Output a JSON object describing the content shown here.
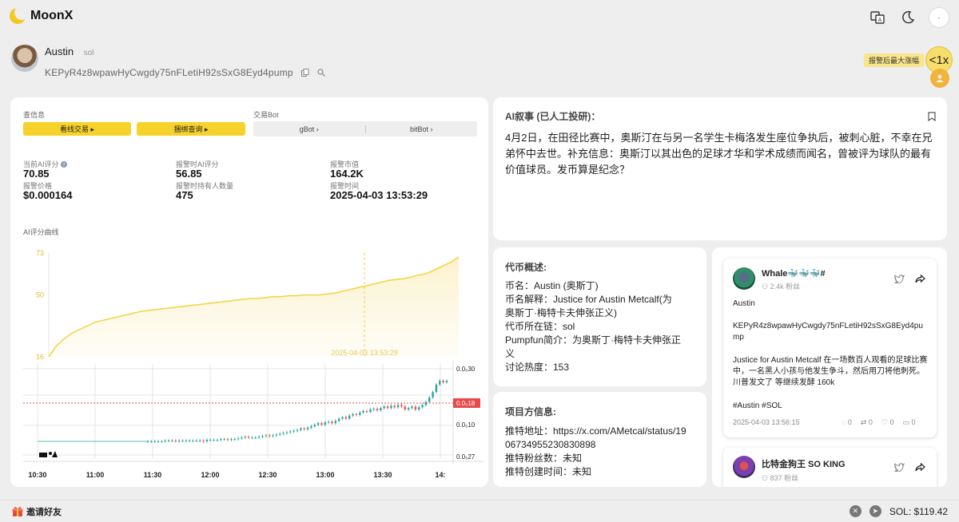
{
  "app": {
    "name": "MoonX"
  },
  "token": {
    "name": "Austin",
    "chain": "sol",
    "address": "KEPyR4z8wpawHyCwgdy75nFLetiH92sSxG8Eyd4pump"
  },
  "header_badges": {
    "max_rise_label": "报警后最大涨幅",
    "multiplier": "<1x"
  },
  "left": {
    "info_label": "查信息",
    "btn_trade": "看线交易 ▸",
    "btn_bundle": "捆绑查询 ▸",
    "bot_label": "交易Bot",
    "gbot": "gBot ›",
    "bitbot": "bitBot ›",
    "stats": {
      "cur_ai_label": "当前AI评分",
      "cur_ai_value": "70.85",
      "alert_ai_label": "报警时AI评分",
      "alert_ai_value": "56.85",
      "alert_mcap_label": "报警市值",
      "alert_mcap_value": "164.2K",
      "alert_price_label": "报警价格",
      "alert_price_value": "$0.000164",
      "holders_label": "报警时持有人数量",
      "holders_value": "475",
      "alert_time_label": "报警时间",
      "alert_time_value": "2025-04-03 13:53:29"
    },
    "curve_label": "AI评分曲线"
  },
  "chart_data": [
    {
      "type": "area",
      "title": "AI评分曲线",
      "y_ticks": [
        "73",
        "50",
        "16"
      ],
      "ylim": [
        16,
        73
      ],
      "marker_label": "2025-04-03 13:53:29",
      "marker_fraction": 0.77,
      "series": [
        {
          "values": [
            16,
            22,
            26,
            29,
            31,
            33,
            35,
            36,
            37,
            38,
            39,
            40,
            41,
            41.5,
            42,
            42.5,
            43,
            43.5,
            44,
            44.5,
            45,
            45.5,
            46,
            46.5,
            47,
            47.5,
            48,
            48,
            48.5,
            49,
            49,
            49.5,
            49.5,
            50,
            50,
            50,
            50.5,
            51,
            52,
            53,
            54,
            55,
            56,
            57,
            58,
            58.5,
            59,
            60,
            61,
            62,
            64,
            66,
            68,
            70.85
          ]
        }
      ]
    },
    {
      "type": "candlestick",
      "x_ticks": [
        "10:30",
        "11:00",
        "11:30",
        "12:00",
        "12:30",
        "13:00",
        "13:30",
        "14:"
      ],
      "y_ticks": [
        "0.0₅30",
        "0.0₅10",
        "0.0₅27"
      ],
      "current_price_label": "0.0₅18",
      "close": [
        0.2,
        0.2,
        0.2,
        0.2,
        0.2,
        0.21,
        0.21,
        0.21,
        0.2,
        0.21,
        0.21,
        0.21,
        0.21,
        0.21,
        0.21,
        0.21,
        0.2,
        0.22,
        0.22,
        0.22,
        0.22,
        0.23,
        0.23,
        0.22,
        0.23,
        0.23,
        0.24,
        0.25,
        0.26,
        0.25,
        0.25,
        0.25,
        0.26,
        0.27,
        0.28,
        0.27,
        0.28,
        0.29,
        0.3,
        0.31,
        0.32,
        0.33,
        0.34,
        0.35,
        0.37,
        0.36,
        0.38,
        0.4,
        0.42,
        0.44,
        0.42,
        0.45,
        0.46,
        0.44,
        0.47,
        0.5,
        0.52,
        0.5,
        0.54,
        0.56,
        0.55,
        0.58,
        0.6,
        0.59,
        0.62,
        0.63,
        0.61,
        0.64,
        0.66,
        0.64,
        0.67,
        0.65,
        0.68,
        0.66,
        0.62,
        0.64,
        0.66,
        0.62,
        0.65,
        0.68,
        0.72,
        0.78,
        0.85,
        0.95,
        1.0,
        0.98,
        1.0
      ]
    }
  ],
  "ai_narrative": {
    "title": "AI叙事 (已人工投研)：",
    "body": "4月2日，在田径比赛中，奥斯汀在与另一名学生卡梅洛发生座位争执后，被刺心脏，不幸在兄弟怀中去世。补充信息：奥斯汀以其出色的足球才华和学术成绩而闻名，曾被评为球队的最有价值球员。发币算是纪念？"
  },
  "coin_overview": {
    "title": "代币概述:",
    "lines": [
      "币名：Austin (奥斯丁)",
      "币名解释：Justice for Austin Metcalf(为",
      "奥斯丁·梅特卡夫伸张正义)",
      "代币所在链：sol",
      "Pumpfun简介：为奥斯丁·梅特卡夫伸张正",
      "义",
      "讨论热度：153"
    ]
  },
  "project_info": {
    "title": "项目方信息:",
    "lines": [
      "推特地址：https://x.com/AMetcal/status/19",
      "06734955230830898",
      "推特粉丝数：未知",
      "推特创建时间：未知"
    ]
  },
  "tweets": [
    {
      "name": "Whale🐳🐳🐳#",
      "fans": "2.4k 粉丝",
      "p1": "Austin",
      "p2": "KEPyR4z8wpawHyCwgdy75nFLetiH92sSxG8Eyd4pu",
      "p2b": "mp",
      "p3": "Justice for Austin Metcalf 在一场数百人观看的足球比赛中，一名黑人小孩与他发生争斗，然后用刀将他刺死。 川普发文了 等继续发酵 160k",
      "p4": "#Austin #SOL",
      "time": "2025-04-03 13:56:15",
      "c1": "0",
      "c2": "0",
      "c3": "0",
      "c4": "0"
    },
    {
      "name": "比特金狗王 SO KING",
      "fans": "837 粉丝"
    }
  ],
  "bottom": {
    "invite": "邀请好友",
    "sol_price": "SOL:  $119.42"
  },
  "colors": {
    "accent": "#f7d22b",
    "curve": "#f5d446",
    "up": "#26a69a",
    "down": "#ef5350",
    "price_line": "#e64a4a"
  }
}
